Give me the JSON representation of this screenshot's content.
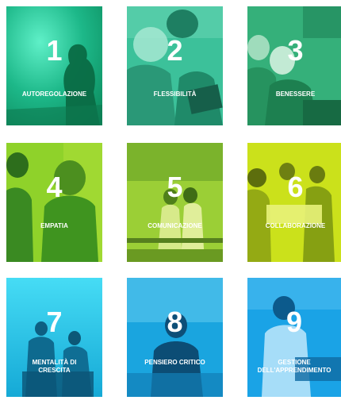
{
  "cards": [
    {
      "number": "1",
      "label": "AUTOREGOLAZIONE",
      "color": "#1fb68a"
    },
    {
      "number": "2",
      "label": "FLESSIBILITÀ",
      "color": "#3fc09a"
    },
    {
      "number": "3",
      "label": "BENESSERE",
      "color": "#33b077"
    },
    {
      "number": "4",
      "label": "EMPATIA",
      "color": "#8fd22a"
    },
    {
      "number": "5",
      "label": "COMUNICAZIONE",
      "color": "#8cc72d"
    },
    {
      "number": "6",
      "label": "COLLABORAZIONE",
      "color": "#c9df1a"
    },
    {
      "number": "7",
      "label": "MENTALITÀ DI\nCRESCITA",
      "color": "#1bc2e4"
    },
    {
      "number": "8",
      "label": "PENSIERO CRITICO",
      "color": "#17a6e0"
    },
    {
      "number": "9",
      "label": "GESTIONE\nDELL'APPRENDIMENTO",
      "color": "#1aa3e6"
    }
  ]
}
